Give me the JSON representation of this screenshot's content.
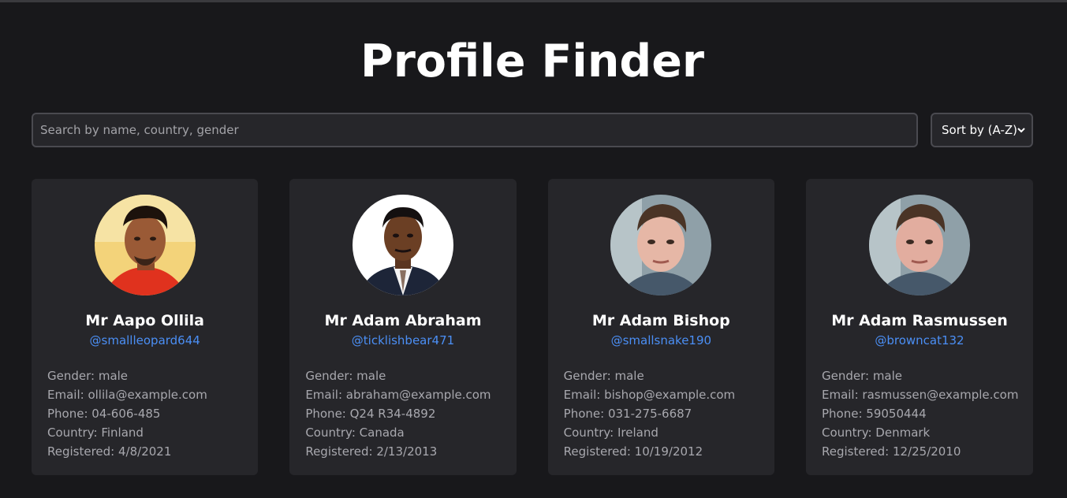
{
  "header": {
    "title": "Profile Finder"
  },
  "search": {
    "placeholder": "Search by name, country, gender"
  },
  "sort": {
    "selected": "Sort by (A-Z)"
  },
  "labels": {
    "gender": "Gender: ",
    "email": "Email: ",
    "phone": "Phone: ",
    "country": "Country: ",
    "registered": "Registered: "
  },
  "profiles": [
    {
      "name": "Mr Aapo Ollila",
      "handle": "@smallleopard644",
      "gender": "Gender: male",
      "email": "Email: ollila@example.com",
      "phone": "Phone: 04-606-485",
      "country": "Country: Finland",
      "registered": "Registered: 4/8/2021"
    },
    {
      "name": "Mr Adam Abraham",
      "handle": "@ticklishbear471",
      "gender": "Gender: male",
      "email": "Email: abraham@example.com",
      "phone": "Phone: Q24 R34-4892",
      "country": "Country: Canada",
      "registered": "Registered: 2/13/2013"
    },
    {
      "name": "Mr Adam Bishop",
      "handle": "@smallsnake190",
      "gender": "Gender: male",
      "email": "Email: bishop@example.com",
      "phone": "Phone: 031-275-6687",
      "country": "Country: Ireland",
      "registered": "Registered: 10/19/2012"
    },
    {
      "name": "Mr Adam Rasmussen",
      "handle": "@browncat132",
      "gender": "Gender: male",
      "email": "Email: rasmussen@example.com",
      "phone": "Phone: 59050444",
      "country": "Country: Denmark",
      "registered": "Registered: 12/25/2010"
    }
  ],
  "colors": {
    "background": "#18181b",
    "card": "#26262a",
    "accent_link": "#4b8ff5",
    "muted_text": "#a8a8ae"
  }
}
